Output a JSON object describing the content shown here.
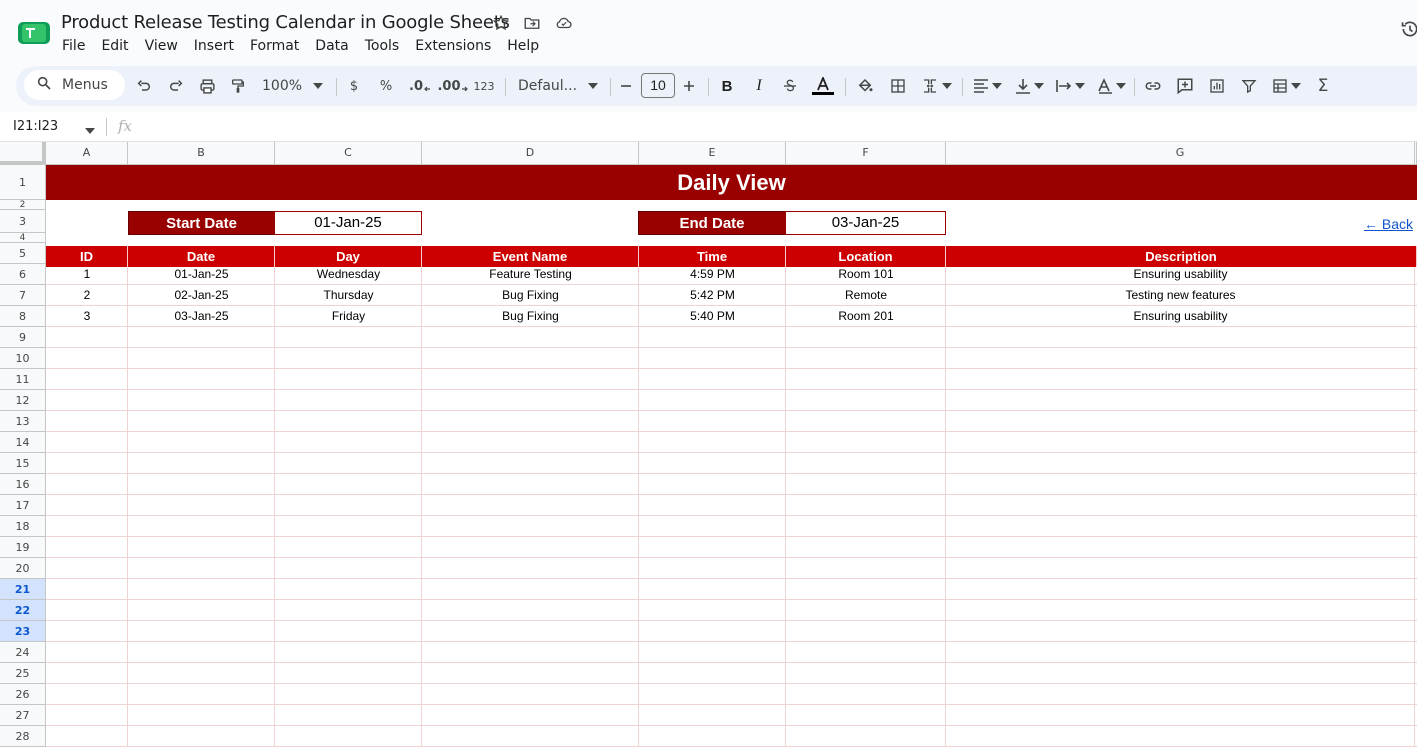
{
  "doc": {
    "title": "Product Release Testing Calendar in Google Sheets"
  },
  "menubar": [
    "File",
    "Edit",
    "View",
    "Insert",
    "Format",
    "Data",
    "Tools",
    "Extensions",
    "Help"
  ],
  "toolbar": {
    "search_label": "Menus",
    "zoom": "100%",
    "currency": "$",
    "percent": "%",
    "decimal_decrease": ".0",
    "decimal_increase": ".00",
    "number_format": "123",
    "font": "Defaul...",
    "font_size": "10",
    "functions": "Σ"
  },
  "formula_bar": {
    "name_box": "I21:I23",
    "fx": "fx"
  },
  "columns": [
    "A",
    "B",
    "C",
    "D",
    "E",
    "F",
    "G"
  ],
  "rows": [
    "1",
    "2",
    "3",
    "4",
    "5",
    "6",
    "7",
    "8",
    "9",
    "10",
    "11",
    "12",
    "13",
    "14",
    "15",
    "16",
    "17",
    "18",
    "19",
    "20",
    "21",
    "22",
    "23",
    "24",
    "25",
    "26",
    "27",
    "28"
  ],
  "selected_rows": [
    "21",
    "22",
    "23"
  ],
  "sheet": {
    "title": "Daily View",
    "start_label": "Start Date",
    "start_value": "01-Jan-25",
    "end_label": "End Date",
    "end_value": "03-Jan-25",
    "back_link": "← Back",
    "headers": [
      "ID",
      "Date",
      "Day",
      "Event Name",
      "Time",
      "Location",
      "Description"
    ],
    "rows": [
      [
        "1",
        "01-Jan-25",
        "Wednesday",
        "Feature Testing",
        "4:59 PM",
        "Room 101",
        "Ensuring usability"
      ],
      [
        "2",
        "02-Jan-25",
        "Thursday",
        "Bug Fixing",
        "5:42 PM",
        "Remote",
        "Testing new features"
      ],
      [
        "3",
        "03-Jan-25",
        "Friday",
        "Bug Fixing",
        "5:40 PM",
        "Room 201",
        "Ensuring usability"
      ]
    ]
  },
  "colors": {
    "banner": "#990000",
    "header": "#cc0000",
    "gridline": "#f0d4d4",
    "selection": "#d3e3fd"
  }
}
